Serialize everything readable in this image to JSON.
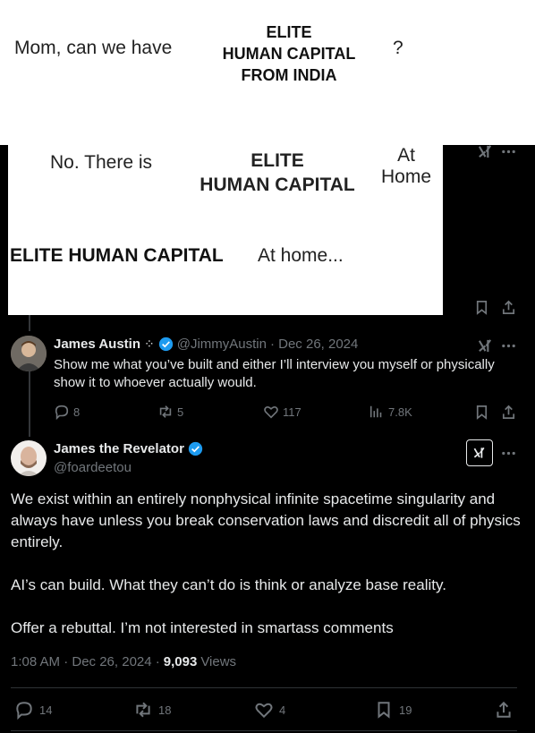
{
  "meme": {
    "top": {
      "left": "Mom, can we have",
      "middle": "ELITE\nHUMAN CAPITAL\nFROM INDIA",
      "right": "?"
    },
    "bottom": {
      "left": "No. There is",
      "middle": "ELITE\nHUMAN CAPITAL",
      "right": "At\nHome",
      "row2_left": "ELITE HUMAN CAPITAL",
      "row2_right": "At home..."
    }
  },
  "reply": {
    "name": "James Austin",
    "badge_symbol": "⁘",
    "handle": "@JimmyAustin",
    "date": "· Dec 26, 2024",
    "text": "Show me what you’ve built and either I’ll interview you myself or physically show it to whoever actually would.",
    "actions": {
      "replies": "8",
      "reposts": "5",
      "likes": "117",
      "views": "7.8K"
    }
  },
  "main_post": {
    "name": "James the Revelator",
    "handle": "@foardeetou",
    "paragraphs": [
      "We exist within an entirely nonphysical infinite spacetime singularity and always have unless you break conservation laws and discredit all of physics entirely.",
      "AI’s can build. What they can’t do is think or analyze base reality.",
      "Offer a rebuttal. I’m not interested in smartass comments"
    ],
    "timestamp": "1:08 AM · Dec 26, 2024 ·",
    "views_count": "9,093",
    "views_label": "Views",
    "actions": {
      "replies": "14",
      "reposts": "18",
      "likes": "4",
      "bookmarks": "19"
    }
  },
  "colors": {
    "background": "#000000",
    "text": "#e7e9ea",
    "muted": "#71767b",
    "verified": "#1d9bf0"
  },
  "icons": [
    "grok-icon",
    "more-icon",
    "bookmark-icon",
    "share-icon",
    "reply-icon",
    "repost-icon",
    "like-icon",
    "views-icon",
    "verified-icon"
  ]
}
